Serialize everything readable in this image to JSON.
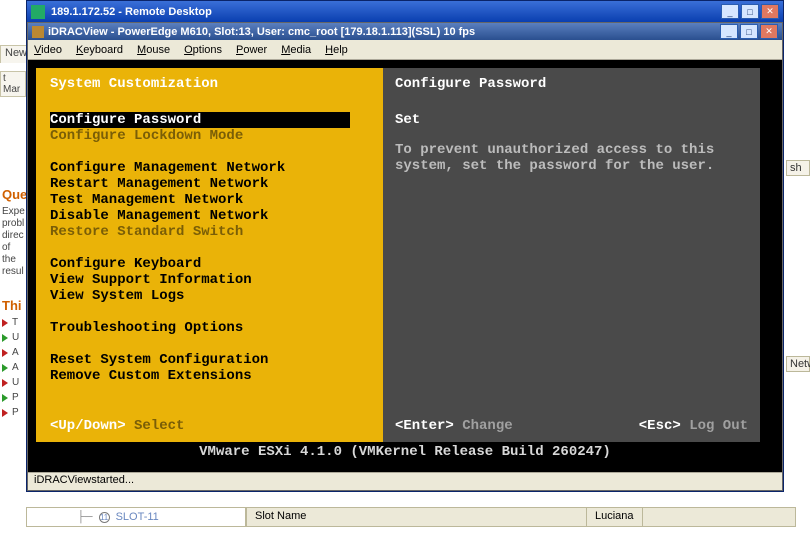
{
  "rdp": {
    "title": "189.1.172.52 - Remote Desktop"
  },
  "idrac": {
    "title": "iDRACView - PowerEdge M610, Slot:13, User: cmc_root  [179.18.1.113](SSL)  10 fps",
    "status": "iDRACViewstarted..."
  },
  "menubar": {
    "items": [
      "Video",
      "Keyboard",
      "Mouse",
      "Options",
      "Power",
      "Media",
      "Help"
    ]
  },
  "left_panel": {
    "title": "System Customization",
    "groups": [
      [
        {
          "label": "Configure Password",
          "selected": true
        },
        {
          "label": "Configure Lockdown Mode",
          "disabled": true
        }
      ],
      [
        {
          "label": "Configure Management Network"
        },
        {
          "label": "Restart Management Network"
        },
        {
          "label": "Test Management Network"
        },
        {
          "label": "Disable Management Network"
        },
        {
          "label": "Restore Standard Switch",
          "disabled": true
        }
      ],
      [
        {
          "label": "Configure Keyboard"
        },
        {
          "label": "View Support Information"
        },
        {
          "label": "View System Logs"
        }
      ],
      [
        {
          "label": "Troubleshooting Options"
        }
      ],
      [
        {
          "label": "Reset System Configuration"
        },
        {
          "label": "Remove Custom Extensions"
        }
      ]
    ],
    "footer_key": "<Up/Down>",
    "footer_action": "Select"
  },
  "right_panel": {
    "title": "Configure Password",
    "detail_title": "Set",
    "detail_body": "To prevent unauthorized access to this system, set the password for the user.",
    "footer_enter_key": "<Enter>",
    "footer_enter_action": "Change",
    "footer_esc_key": "<Esc>",
    "footer_esc_action": "Log Out"
  },
  "vmware_line": "VMware ESXi 4.1.0 (VMKernel Release Build 260247)",
  "background": {
    "browser_tab": "New C",
    "left_tab": "t Mar",
    "que_heading": "Que",
    "que_text": "Expe\nprobl\ndirec\nof the\nresul",
    "thi_heading": "Thi",
    "row_letters": [
      "T",
      "U",
      "A",
      "A",
      "U",
      "P",
      "P"
    ],
    "right_tab1": "sh",
    "right_tab2": "Netw"
  },
  "bottom": {
    "node_num": "11",
    "node_label": "SLOT-11",
    "col1": "Slot Name",
    "col2": "Luciana"
  }
}
